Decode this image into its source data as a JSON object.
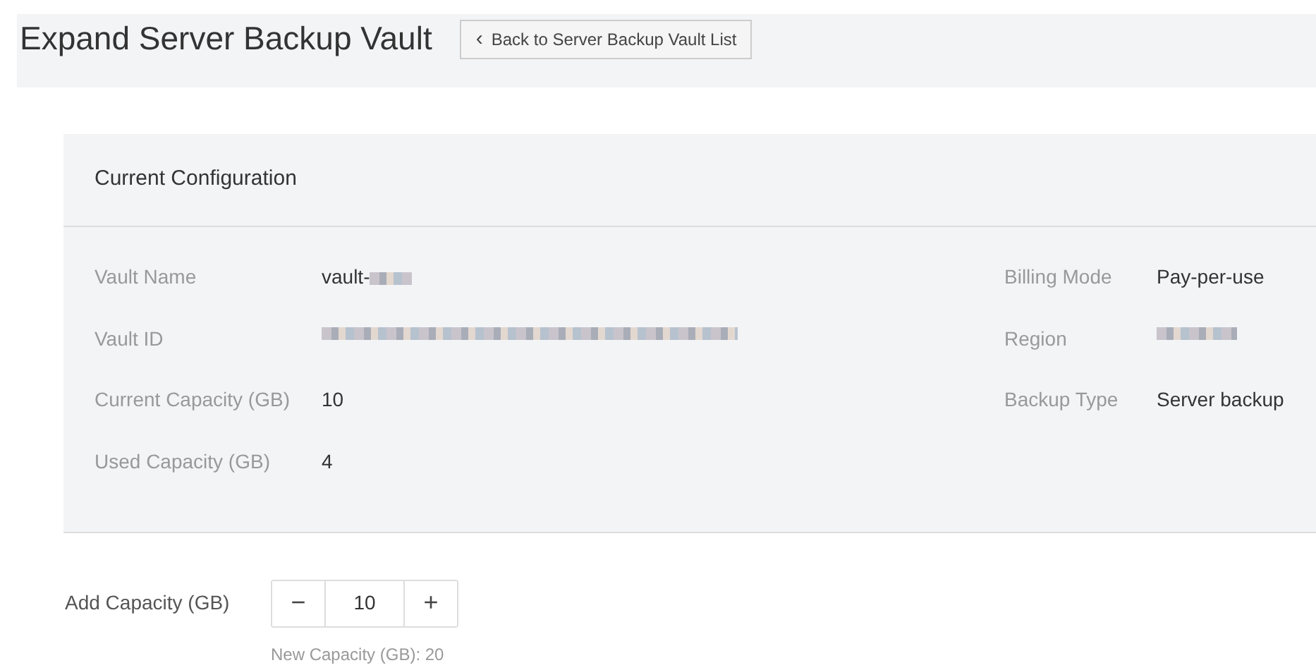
{
  "page_title": "Expand Server Backup Vault",
  "back_button": {
    "icon": "‹",
    "label": "Back to Server Backup Vault List"
  },
  "current_configuration": {
    "title": "Current Configuration",
    "left_fields": [
      {
        "label": "Vault Name",
        "value": "vault-",
        "kind": "redacted"
      },
      {
        "label": "Vault ID",
        "kind": "redacted"
      },
      {
        "label": "Current Capacity (GB)",
        "value": "10",
        "kind": "text"
      },
      {
        "label": "Used Capacity (GB)",
        "value": "4",
        "kind": "text"
      }
    ],
    "right_fields": [
      {
        "label": "Billing Mode",
        "value": "Pay-per-use",
        "kind": "text"
      },
      {
        "label": "Region",
        "kind": "redacted"
      },
      {
        "label": "Backup Type",
        "value": "Server backup",
        "kind": "text"
      }
    ]
  },
  "add_capacity": {
    "label": "Add Capacity (GB)",
    "minus": "−",
    "value": "10",
    "plus": "+",
    "hint": "New Capacity (GB): 20"
  }
}
